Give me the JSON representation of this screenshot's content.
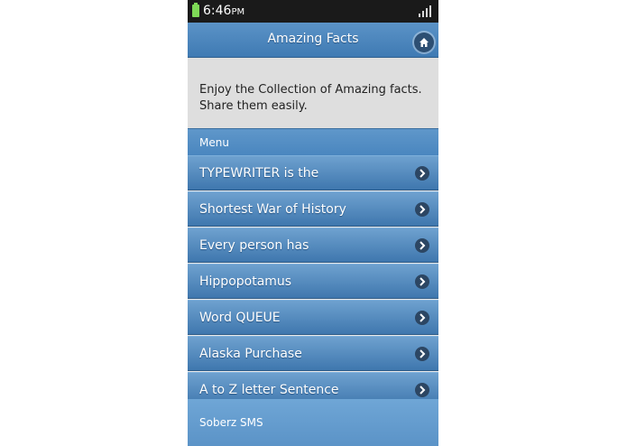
{
  "status_bar": {
    "time": "6:46",
    "ampm": "PM"
  },
  "header": {
    "title": "Amazing Facts",
    "home_icon": "home-icon"
  },
  "intro": {
    "text": "Enjoy the Collection of Amazing facts. Share them easily."
  },
  "menu": {
    "divider_label": "Menu",
    "items": [
      {
        "label": "TYPEWRITER is the",
        "icon": "chevron-right-icon"
      },
      {
        "label": "Shortest War of History",
        "icon": "chevron-right-icon"
      },
      {
        "label": "Every person has",
        "icon": "chevron-right-icon"
      },
      {
        "label": "Hippopotamus",
        "icon": "chevron-right-icon"
      },
      {
        "label": "Word QUEUE",
        "icon": "chevron-right-icon"
      },
      {
        "label": "Alaska Purchase",
        "icon": "chevron-right-icon"
      },
      {
        "label": "A to Z letter Sentence",
        "icon": "chevron-right-icon"
      }
    ]
  },
  "footer": {
    "text": "Soberz SMS"
  },
  "colors": {
    "header": "#4f88bd",
    "list_item": "#4f88bd",
    "intro_bg": "#dedede",
    "status_bar": "#1a1a1a",
    "battery": "#7ed957"
  }
}
